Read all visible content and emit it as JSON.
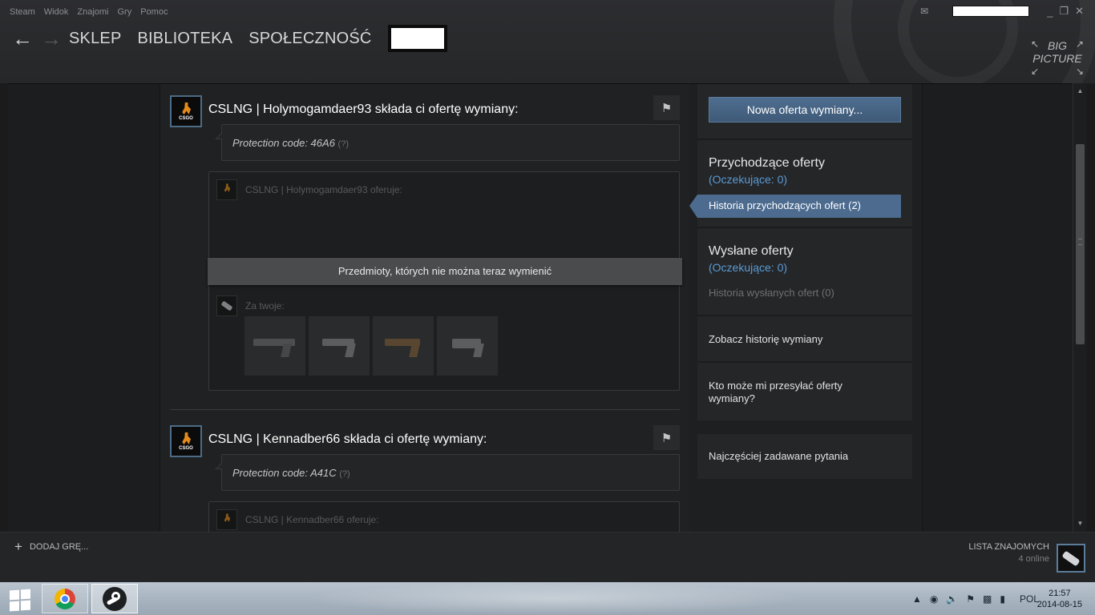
{
  "menu": [
    "Steam",
    "Widok",
    "Znajomi",
    "Gry",
    "Pomoc"
  ],
  "nav": {
    "back_icon": "←",
    "forward_icon": "→",
    "links": [
      "SKLEP",
      "BIBLIOTEKA",
      "SPOŁECZNOŚĆ"
    ]
  },
  "big_picture": {
    "line1": "BIG",
    "line2": "PICTURE"
  },
  "window_controls": {
    "minimize": "_",
    "restore": "❐",
    "close": "✕"
  },
  "offers": [
    {
      "title": "CSLNG | Holymogamdaer93 składa ci ofertę wymiany:",
      "protection": "Protection code: 46A6",
      "help": "(?)",
      "their_label": "CSLNG | Holymogamdaer93 oferuje:",
      "banner": "Przedmioty, których nie można teraz wymienić",
      "your_label": "Za twoje:"
    },
    {
      "title": "CSLNG | Kennadber66 składa ci ofertę wymiany:",
      "protection": "Protection code: A41C",
      "help": "(?)",
      "their_label": "CSLNG | Kennadber66 oferuje:"
    }
  ],
  "avatar_text": "CSGO",
  "flag_icon": "⚑",
  "sidebar": {
    "new_offer": "Nowa oferta wymiany...",
    "incoming_title": "Przychodzące oferty",
    "incoming_pending": "(Oczekujące: 0)",
    "incoming_history": "Historia przychodzących ofert (2)",
    "sent_title": "Wysłane oferty",
    "sent_pending": "(Oczekujące: 0)",
    "sent_history": "Historia wysłanych ofert (0)",
    "trade_history": "Zobacz historię wymiany",
    "who_can": "Kto może mi przesyłać oferty wymiany?",
    "faq": "Najczęściej zadawane pytania"
  },
  "bottom": {
    "add_game": "DODAJ GRĘ...",
    "add_icon": "+",
    "friends": "LISTA ZNAJOMYCH",
    "online": "4 online"
  },
  "taskbar": {
    "tray_language": "POL",
    "time": "21:57",
    "date": "2014-08-15"
  },
  "colors": {
    "accent": "#4c6b8f",
    "link": "#5a9bd5",
    "background": "#1e1f20"
  }
}
